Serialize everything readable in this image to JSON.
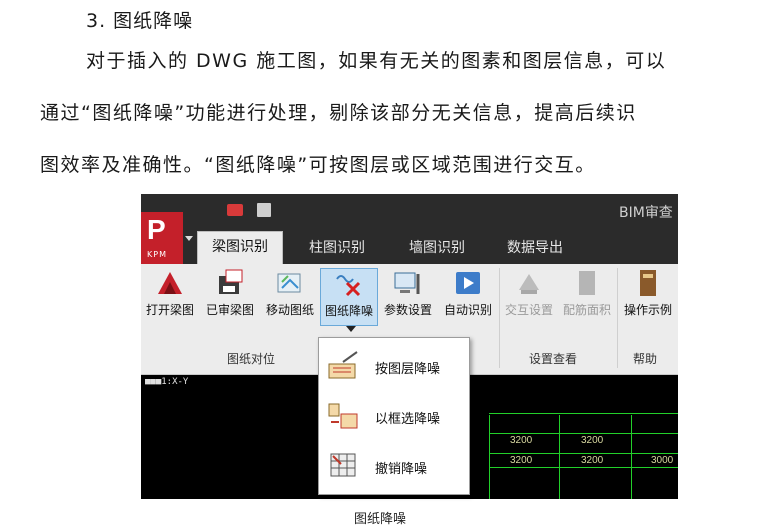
{
  "heading": "3.  图纸降噪",
  "paragraph": {
    "line1": "对于插入的 DWG 施工图，如果有无关的图素和图层信息，可以",
    "line2": "通过“图纸降噪”功能进行处理，剔除该部分无关信息，提高后续识",
    "line3": "图效率及准确性。“图纸降噪”可按图层或区域范围进行交互。"
  },
  "screenshot": {
    "app_title": "BIM审查",
    "logo_text": "P",
    "logo_sub": "KPM",
    "tabs": [
      "梁图识别",
      "柱图识别",
      "墙图识别",
      "数据导出"
    ],
    "active_tab": "梁图识别",
    "buttons": [
      {
        "label": "打开梁图",
        "icon": "open-beam-drawing-icon",
        "enabled": true
      },
      {
        "label": "已审梁图",
        "icon": "reviewed-drawing-icon",
        "enabled": true
      },
      {
        "label": "移动图纸",
        "icon": "move-drawing-icon",
        "enabled": true
      },
      {
        "label": "图纸降噪",
        "icon": "denoise-icon",
        "enabled": true,
        "selected": true
      },
      {
        "label": "参数设置",
        "icon": "parameter-settings-icon",
        "enabled": true
      },
      {
        "label": "自动识别",
        "icon": "auto-recognize-icon",
        "enabled": true
      },
      {
        "label": "交互设置",
        "icon": "interaction-settings-icon",
        "enabled": false
      },
      {
        "label": "配筋面积",
        "icon": "rebar-area-icon",
        "enabled": false
      },
      {
        "label": "操作示例",
        "icon": "manual-book-icon",
        "enabled": true
      }
    ],
    "groups": {
      "drawing_position": "图纸对位",
      "settings_view": "设置查看",
      "help": "帮助"
    },
    "canvas_coord": "■■■1:X-Y",
    "dimensions_row1": [
      "3200",
      "3200"
    ],
    "dimensions_row2": [
      "3200",
      "3200",
      "3000"
    ],
    "dropdown_menu": [
      {
        "label": "按图层降噪",
        "icon": "layer-denoise-icon"
      },
      {
        "label": "以框选降噪",
        "icon": "box-select-denoise-icon"
      },
      {
        "label": "撤销降噪",
        "icon": "undo-denoise-icon"
      }
    ],
    "colors": {
      "titlebar": "#2b2b2b",
      "logo": "#c4202a",
      "selected_button": "#c7e0f4",
      "cad_line": "#22d02a"
    }
  },
  "caption": "图纸降噪"
}
